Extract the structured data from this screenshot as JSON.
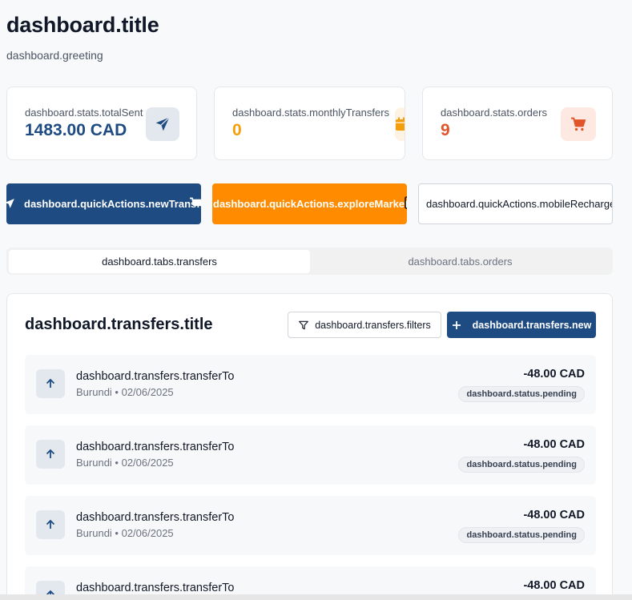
{
  "header": {
    "title": "dashboard.title",
    "greeting": "dashboard.greeting"
  },
  "stats": [
    {
      "label": "dashboard.stats.totalSent",
      "value": "1483.00 CAD",
      "icon": "paper-plane-icon",
      "color": "#1e4b82",
      "icon_bg": "#e3e8ef"
    },
    {
      "label": "dashboard.stats.monthlyTransfers",
      "value": "0",
      "icon": "calendar-icon",
      "color": "#f59e0b",
      "icon_bg": "#fef3e2"
    },
    {
      "label": "dashboard.stats.orders",
      "value": "9",
      "icon": "cart-icon",
      "color": "#e0552b",
      "icon_bg": "#fde9e2"
    }
  ],
  "quick_actions": {
    "new_transfer": "dashboard.quickActions.newTransfer",
    "explore_marketplace": "dashboard.quickActions.exploreMarketplace",
    "mobile_recharge": "dashboard.quickActions.mobileRecharge"
  },
  "tabs": {
    "transfers": "dashboard.tabs.transfers",
    "orders": "dashboard.tabs.orders",
    "active": "transfers"
  },
  "transfers": {
    "title": "dashboard.transfers.title",
    "filters_label": "dashboard.transfers.filters",
    "new_label": "dashboard.transfers.new",
    "items": [
      {
        "title": "dashboard.transfers.transferTo",
        "country": "Burundi",
        "date": "02/06/2025",
        "amount": "-48.00 CAD",
        "status": "dashboard.status.pending"
      },
      {
        "title": "dashboard.transfers.transferTo",
        "country": "Burundi",
        "date": "02/06/2025",
        "amount": "-48.00 CAD",
        "status": "dashboard.status.pending"
      },
      {
        "title": "dashboard.transfers.transferTo",
        "country": "Burundi",
        "date": "02/06/2025",
        "amount": "-48.00 CAD",
        "status": "dashboard.status.pending"
      },
      {
        "title": "dashboard.transfers.transferTo",
        "country": "",
        "date": "",
        "amount": "-48.00 CAD",
        "status": ""
      }
    ]
  },
  "colors": {
    "primary": "#1e4b82",
    "accent": "#ff8c00",
    "orange_stat": "#f59e0b",
    "red_stat": "#e0552b"
  }
}
